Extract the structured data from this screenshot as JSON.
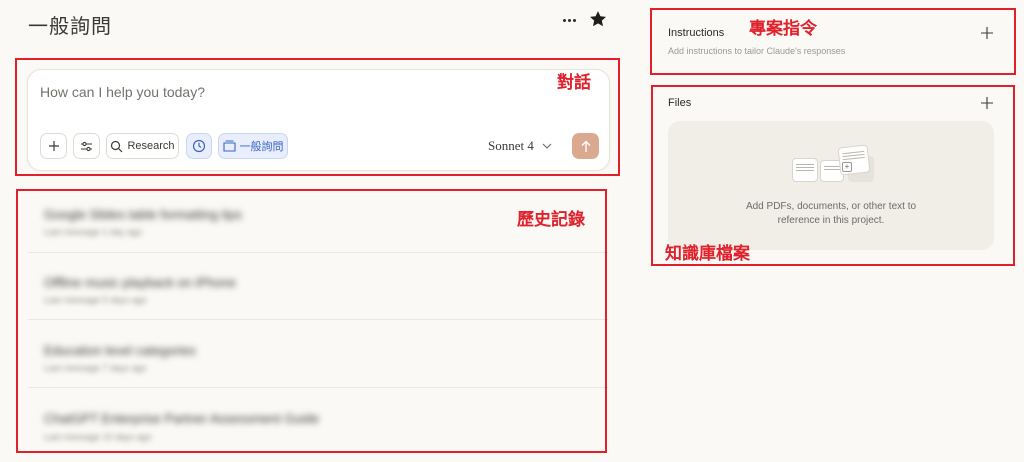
{
  "header": {
    "title": "一般詢問"
  },
  "annotations": {
    "chat": "對話",
    "history": "歷史記錄",
    "instructions": "專案指令",
    "files": "知識庫檔案"
  },
  "chat": {
    "placeholder": "How can I help you today?",
    "research_label": "Research",
    "project_label": "一般詢問",
    "model_label": "Sonnet 4"
  },
  "history": {
    "items": [
      {
        "title": "Google Slides table formatting tips",
        "subtitle": "Last message 1 day ago"
      },
      {
        "title": "Offline music playback on iPhone",
        "subtitle": "Last message 5 days ago"
      },
      {
        "title": "Education level categories",
        "subtitle": "Last message 7 days ago"
      },
      {
        "title": "ChatGPT Enterprise Partner Assessment Guide",
        "subtitle": "Last message 10 days ago"
      }
    ]
  },
  "instructions": {
    "title": "Instructions",
    "description": "Add instructions to tailor Claude's responses"
  },
  "files": {
    "title": "Files",
    "drop_line1": "Add PDFs, documents, or other text to",
    "drop_line2": "reference in this project."
  },
  "colors": {
    "background": "#faf9f5",
    "annotation_red": "#e0202a",
    "send_button": "#dba98f",
    "accent_blue": "#3a63c7"
  }
}
